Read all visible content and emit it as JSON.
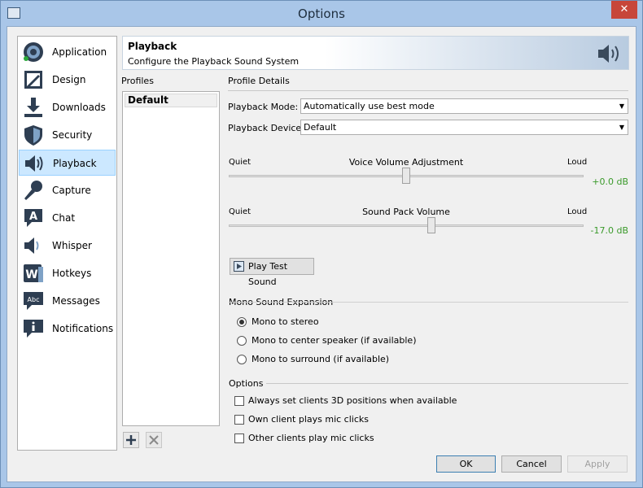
{
  "window": {
    "title": "Options",
    "close_glyph": "✕"
  },
  "categories": [
    {
      "label": "Application",
      "icon": "teamspeak-icon",
      "selected": false
    },
    {
      "label": "Design",
      "icon": "design-icon",
      "selected": false
    },
    {
      "label": "Downloads",
      "icon": "download-icon",
      "selected": false
    },
    {
      "label": "Security",
      "icon": "shield-icon",
      "selected": false
    },
    {
      "label": "Playback",
      "icon": "speaker-icon",
      "selected": true
    },
    {
      "label": "Capture",
      "icon": "microphone-icon",
      "selected": false
    },
    {
      "label": "Chat",
      "icon": "chat-icon",
      "selected": false
    },
    {
      "label": "Whisper",
      "icon": "whisper-icon",
      "selected": false
    },
    {
      "label": "Hotkeys",
      "icon": "hotkeys-icon",
      "selected": false
    },
    {
      "label": "Messages",
      "icon": "messages-icon",
      "selected": false
    },
    {
      "label": "Notifications",
      "icon": "info-icon",
      "selected": false
    }
  ],
  "banner": {
    "title": "Playback",
    "subtitle": "Configure the Playback Sound System"
  },
  "profiles": {
    "label": "Profiles",
    "items": [
      "Default"
    ]
  },
  "details": {
    "label": "Profile Details",
    "mode_label": "Playback Mode:",
    "mode_value": "Automatically use best mode",
    "device_label": "Playback Device:",
    "device_value": "Default"
  },
  "voice_volume": {
    "title": "Voice Volume Adjustment",
    "min_label": "Quiet",
    "max_label": "Loud",
    "value_text": "+0.0 dB",
    "level": 0.5
  },
  "soundpack_volume": {
    "title": "Sound Pack Volume",
    "min_label": "Quiet",
    "max_label": "Loud",
    "value_text": "-17.0 dB",
    "level": 0.57
  },
  "test_button": "Play Test Sound",
  "mono": {
    "label": "Mono Sound Expansion",
    "options": [
      {
        "label": "Mono to stereo",
        "checked": true
      },
      {
        "label": "Mono to center speaker (if available)",
        "checked": false
      },
      {
        "label": "Mono to surround (if available)",
        "checked": false
      }
    ]
  },
  "options": {
    "label": "Options",
    "items": [
      {
        "label": "Always set clients 3D positions when available",
        "checked": false
      },
      {
        "label": "Own client plays mic clicks",
        "checked": false
      },
      {
        "label": "Other clients play mic clicks",
        "checked": false
      }
    ]
  },
  "buttons": {
    "ok": "OK",
    "cancel": "Cancel",
    "apply": "Apply"
  },
  "colors": {
    "title_bar": "#a9c6e8",
    "selected_item": "#cce8ff",
    "db_text": "#3a9a2a",
    "close_button": "#c7463a"
  }
}
